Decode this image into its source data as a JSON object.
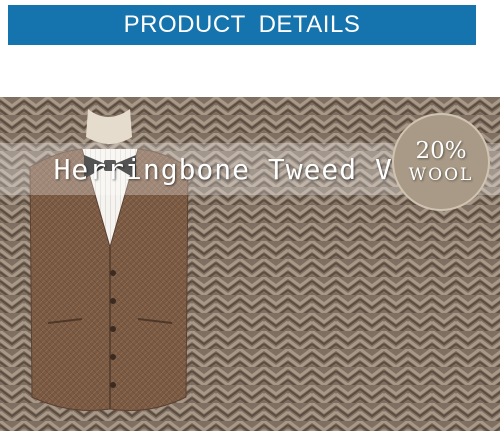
{
  "banner": {
    "title": "PRODUCT DETAILS"
  },
  "product": {
    "name": "Herringbone Tweed Vest"
  },
  "badge": {
    "line1": "20%",
    "line2": "WOOL"
  },
  "colors": {
    "banner": "#1574ad",
    "tweed_dark": "#5a4a3e",
    "tweed_light": "#a9998a",
    "vest": "#7a5a43",
    "shirt": "#f4f2ee",
    "bow_tie": "#111111",
    "badge": "#a89a86"
  }
}
